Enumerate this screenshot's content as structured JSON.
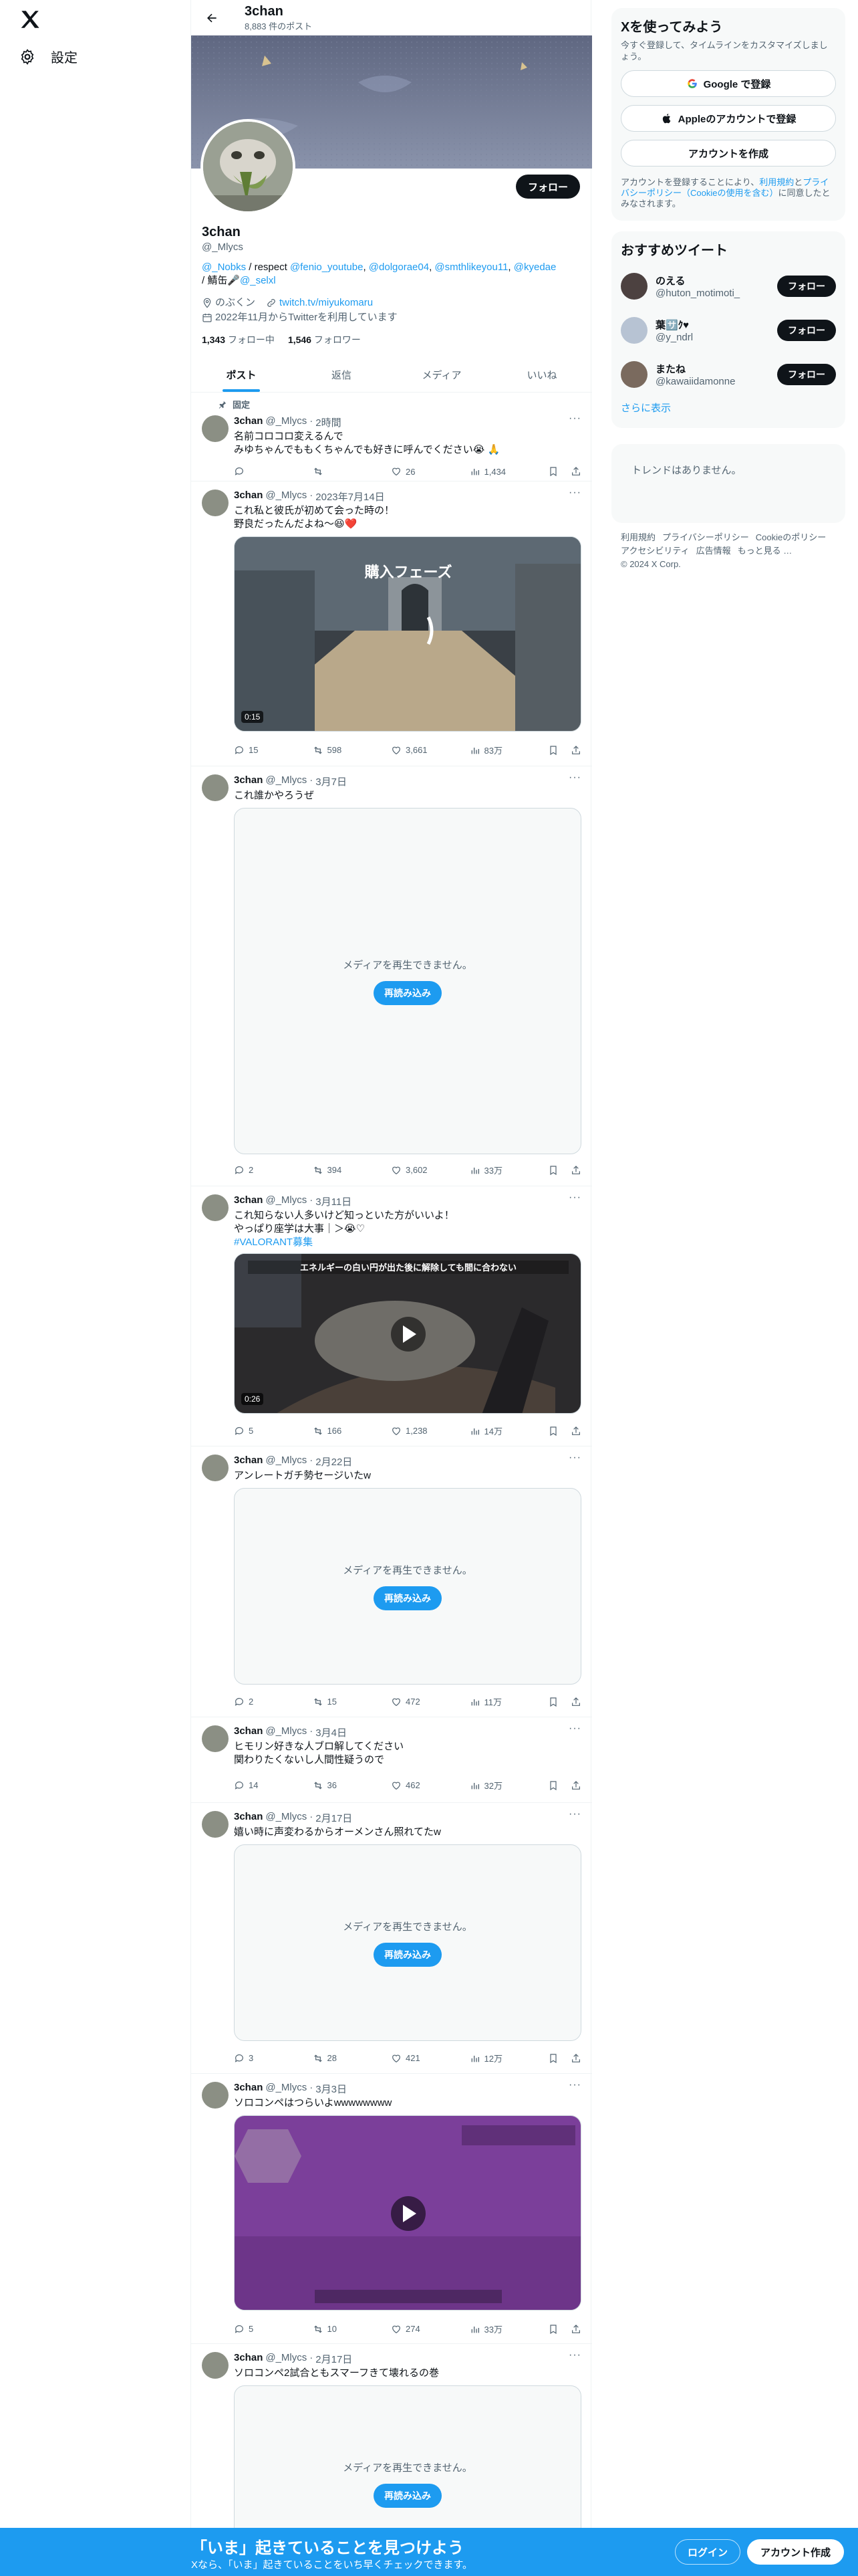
{
  "nav": {
    "settings_label": "設定"
  },
  "header": {
    "title": "3chan",
    "post_count": "8,883 件のポスト"
  },
  "profile": {
    "name": "3chan",
    "handle": "@_Mlycs",
    "follow_label": "フォロー",
    "bio_mentions": [
      "@_Nobks",
      "@fenio_youtube",
      "@dolgorae04",
      "@smthlikeyou11",
      "@kyedae"
    ],
    "bio_respect": " / respect ",
    "bio_sep": ", ",
    "bio_tail": "/ 鯖缶🎤",
    "bio_tail_mention": "@_selxl",
    "location": "のぶくン",
    "website": "twitch.tv/miyukomaru",
    "joined": "2022年11月からTwitterを利用しています",
    "following_count": "1,343",
    "following_label": "フォロー中",
    "followers_count": "1,546",
    "followers_label": "フォロワー"
  },
  "tabs": [
    {
      "label": "ポスト",
      "active": true
    },
    {
      "label": "返信",
      "active": false
    },
    {
      "label": "メディア",
      "active": false
    },
    {
      "label": "いいね",
      "active": false
    }
  ],
  "pinned_label": "固定",
  "tweets": [
    {
      "name": "3chan",
      "handle": "@_Mlycs",
      "time": "2時間",
      "text": "名前コロコロ変えるんで\nみゆちゃんでももくちゃんでも好きに呼んでください😭 🙏",
      "replies": "",
      "retweets": "",
      "likes": "26",
      "views": "1,434"
    },
    {
      "name": "3chan",
      "handle": "@_Mlycs",
      "time": "2023年7月14日",
      "text": "これ私と彼氏が初めて会った時の！\n野良だったんだよね〜😆❤️",
      "media_type": "video",
      "media_overlay": "購入フェーズ",
      "duration": "0:15",
      "replies": "15",
      "retweets": "598",
      "likes": "3,661",
      "views": "83万"
    },
    {
      "name": "3chan",
      "handle": "@_Mlycs",
      "time": "3月7日",
      "text": "これ誰かやろうぜ",
      "media_type": "unavailable",
      "replies": "2",
      "retweets": "394",
      "likes": "3,602",
      "views": "33万"
    },
    {
      "name": "3chan",
      "handle": "@_Mlycs",
      "time": "3月11日",
      "text": "これ知らない人多いけど知っといた方がいいよ！\nやっぱり座学は大事｜＞😭♡",
      "hashtag": "#VALORANT募集",
      "media_type": "video",
      "media_overlay": "エネルギーの白い円が出た後に解除しても間に合わない",
      "duration": "0:26",
      "replies": "5",
      "retweets": "166",
      "likes": "1,238",
      "views": "14万"
    },
    {
      "name": "3chan",
      "handle": "@_Mlycs",
      "time": "2月22日",
      "text": "アンレートガチ勢セージいたw",
      "media_type": "unavailable",
      "replies": "2",
      "retweets": "15",
      "likes": "472",
      "views": "11万"
    },
    {
      "name": "3chan",
      "handle": "@_Mlycs",
      "time": "3月4日",
      "text": "ヒモリン好きな人ブロ解してください\n関わりたくないし人間性疑うので",
      "replies": "14",
      "retweets": "36",
      "likes": "462",
      "views": "32万"
    },
    {
      "name": "3chan",
      "handle": "@_Mlycs",
      "time": "2月17日",
      "text": "嬉い時に声変わるからオーメンさん照れてたw",
      "media_type": "unavailable",
      "replies": "3",
      "retweets": "28",
      "likes": "421",
      "views": "12万"
    },
    {
      "name": "3chan",
      "handle": "@_Mlycs",
      "time": "3月3日",
      "text": "ソロコンペはつらいよwwwwwwww",
      "media_type": "video",
      "replies": "5",
      "retweets": "10",
      "likes": "274",
      "views": "33万"
    },
    {
      "name": "3chan",
      "handle": "@_Mlycs",
      "time": "2月17日",
      "text": "ソロコンペ2試合ともスマーフきて壊れるの巻",
      "media_type": "unavailable"
    }
  ],
  "media_unavailable_text": "メディアを再生できません。",
  "reload_label": "再読み込み",
  "sidebar": {
    "signup_title": "Xを使ってみよう",
    "signup_sub": "今すぐ登録して、タイムラインをカスタマイズしましょう。",
    "google_label": "Google で登録",
    "apple_label": "Appleのアカウントで登録",
    "create_label": "アカウントを作成",
    "legal_prefix": "アカウントを登録することにより、",
    "legal_terms": "利用規約",
    "legal_and": "と",
    "legal_privacy": "プライバシーポリシー（Cookieの使用を含む）",
    "legal_suffix": "に同意したとみなされます。",
    "rec_title": "おすすめツイート",
    "rec_users": [
      {
        "name": "のえる",
        "handle": "@huton_motimoti_",
        "follow": "フォロー"
      },
      {
        "name": "葉🈂️ｸ♥",
        "handle": "@y_ndrl",
        "follow": "フォロー"
      },
      {
        "name": "またね",
        "handle": "@kawaiidamonne",
        "follow": "フォロー"
      }
    ],
    "show_more": "さらに表示",
    "no_trends": "トレンドはありません。",
    "footer": [
      "利用規約",
      "プライバシーポリシー",
      "Cookieのポリシー",
      "アクセシビリティ",
      "広告情報",
      "もっと見る …",
      "© 2024 X Corp."
    ]
  },
  "bottom_bar": {
    "title": "「いま」起きていることを見つけよう",
    "sub": "Xなら、「いま」起きていることをいち早くチェックできます。",
    "login": "ログイン",
    "create": "アカウント作成"
  },
  "colors": {
    "accent": "#1d9bf0",
    "text": "#0f1419",
    "muted": "#536471"
  }
}
